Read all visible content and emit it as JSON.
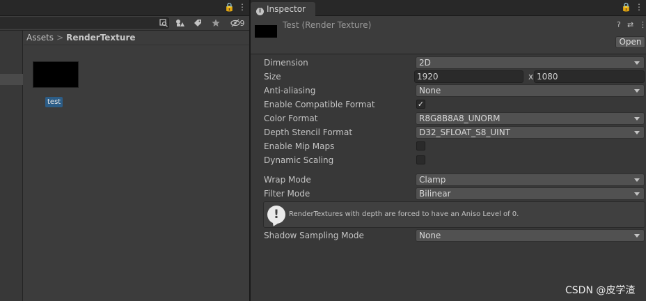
{
  "project": {
    "tab_controls": {
      "lock": "🔒",
      "menu": "⋮"
    },
    "toolbar": {
      "hidden_count": "9"
    },
    "breadcrumb": {
      "root": "Assets",
      "separator": ">",
      "current": "RenderTexture"
    },
    "asset": {
      "name": "test"
    }
  },
  "inspector": {
    "tab_label": "Inspector",
    "tab_icon": "i",
    "tab_controls": {
      "lock": "🔒",
      "menu": "⋮"
    },
    "title": "Test (Render Texture)",
    "header_icons": {
      "help": "?",
      "settings": "⇄",
      "menu": "⋮"
    },
    "open_button": "Open",
    "properties": {
      "dimension": {
        "label": "Dimension",
        "value": "2D"
      },
      "size": {
        "label": "Size",
        "width": "1920",
        "separator": "x",
        "height": "1080"
      },
      "anti_aliasing": {
        "label": "Anti-aliasing",
        "value": "None"
      },
      "enable_compatible_format": {
        "label": "Enable Compatible Format",
        "check": "✓"
      },
      "color_format": {
        "label": "Color Format",
        "value": "R8G8B8A8_UNORM"
      },
      "depth_stencil_format": {
        "label": "Depth Stencil Format",
        "value": "D32_SFLOAT_S8_UINT"
      },
      "enable_mip_maps": {
        "label": "Enable Mip Maps"
      },
      "dynamic_scaling": {
        "label": "Dynamic Scaling"
      },
      "wrap_mode": {
        "label": "Wrap Mode",
        "value": "Clamp"
      },
      "filter_mode": {
        "label": "Filter Mode",
        "value": "Bilinear"
      },
      "shadow_sampling_mode": {
        "label": "Shadow Sampling Mode",
        "value": "None"
      }
    },
    "warning": {
      "icon": "!",
      "message": "RenderTextures with depth are forced to have an Aniso Level of 0."
    }
  },
  "watermark": "CSDN @皮学渣",
  "colors": {
    "selection": "#2c5d87",
    "panel": "#383838",
    "field": "#515151"
  }
}
